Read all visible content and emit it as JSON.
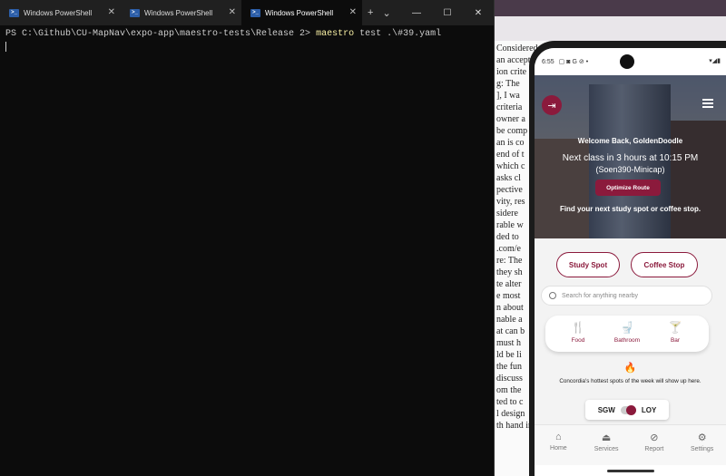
{
  "terminal": {
    "tabs": [
      {
        "label": "Windows PowerShell"
      },
      {
        "label": "Windows PowerShell"
      },
      {
        "label": "Windows PowerShell"
      }
    ],
    "active_tab": 2,
    "new_tab_icon": "+",
    "dropdown_icon": "⌄",
    "prompt": "PS C:\\Github\\CU-MapNav\\expo-app\\maestro-tests\\Release 2>",
    "command_keyword": "maestro",
    "command_args": "test .\\#39.yaml"
  },
  "background_doc": {
    "lines": [
      "Considered",
      "an accept",
      "ion crite",
      "g: The",
      "], I wa",
      "criteria",
      "owner a",
      "be comp",
      "an is co",
      "end of t",
      "which c",
      "asks cl",
      "pective",
      "vity, res",
      "sidere",
      "rable w",
      "ded to",
      ".com/e",
      "re: The",
      "they sh",
      "te alter",
      "e most",
      "n about",
      "nable a",
      "at can b",
      "must h",
      "ld be li",
      "the fun",
      "discuss",
      "om the",
      "ted to c",
      "l design",
      "th hand in"
    ]
  },
  "phone": {
    "status_time": "6:55",
    "hero": {
      "welcome": "Welcome Back, GoldenDoodle",
      "next_class": "Next class in 3 hours at 10:15 PM",
      "course": "(Soen390-Minicap)",
      "optimize_label": "Optimize Route",
      "find_text": "Find your next study spot or coffee stop."
    },
    "quick_buttons": {
      "study": "Study Spot",
      "coffee": "Coffee Stop"
    },
    "search": {
      "placeholder": "Search for anything nearby"
    },
    "categories": [
      {
        "label": "Food",
        "icon": "fork-knife-icon"
      },
      {
        "label": "Bathroom",
        "icon": "toilet-icon"
      },
      {
        "label": "Bar",
        "icon": "cocktail-icon"
      }
    ],
    "hot_text": "Concordia's hottest spots of the week will show up here.",
    "campus_toggle": {
      "left": "SGW",
      "right": "LOY",
      "selected": "LOY"
    },
    "nav": [
      {
        "label": "Home",
        "icon": "home-icon"
      },
      {
        "label": "Services",
        "icon": "services-icon"
      },
      {
        "label": "Report",
        "icon": "report-icon"
      },
      {
        "label": "Settings",
        "icon": "settings-icon"
      }
    ],
    "colors": {
      "accent": "#8b1a3c"
    }
  }
}
